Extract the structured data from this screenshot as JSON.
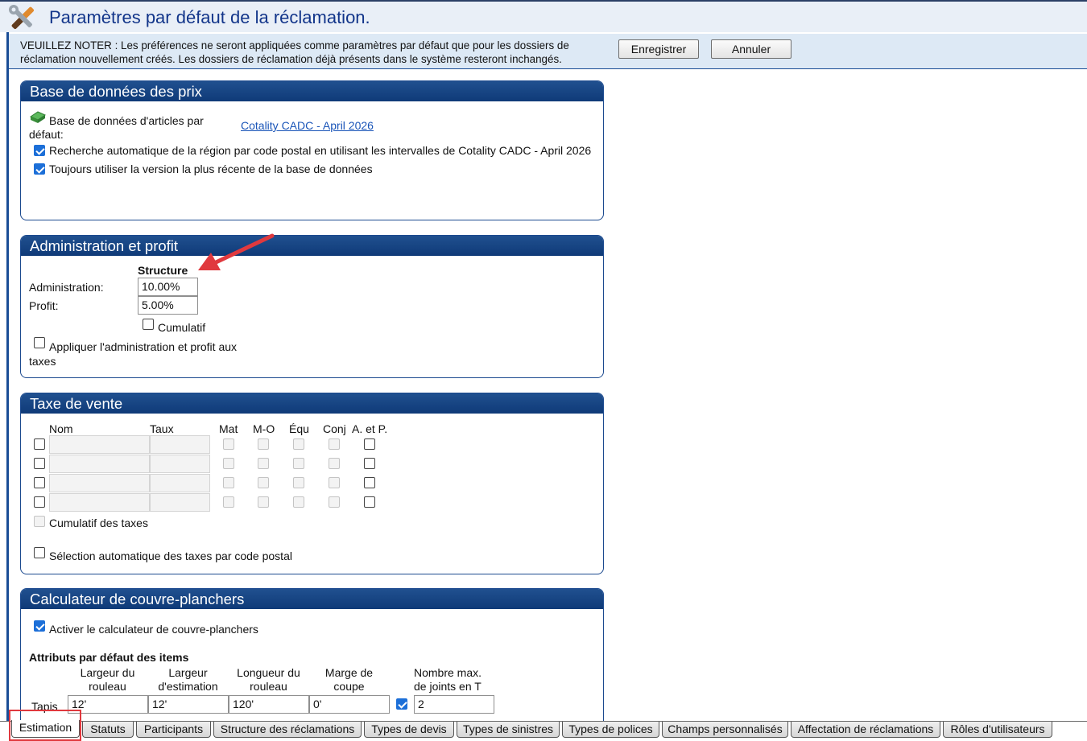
{
  "page": {
    "title": "Paramètres par défaut de la réclamation.",
    "icon": "tools-icon"
  },
  "notice": {
    "text": "VEUILLEZ NOTER : Les préférences ne seront appliquées comme paramètres par défaut que pour les dossiers de réclamation nouvellement créés. Les dossiers de réclamation déjà présents dans le système resteront inchangés.",
    "save_label": "Enregistrer",
    "cancel_label": "Annuler"
  },
  "price_db": {
    "header": "Base de données des prix",
    "default_db_label": "Base de données d'articles par défaut:",
    "default_db_value": "Cotality CADC - April 2026",
    "auto_region_label": "Recherche automatique de la région par code postal en utilisant les intervalles de Cotality CADC - April 2026",
    "auto_region_checked": true,
    "latest_version_label": "Toujours utiliser la version la plus récente de la base de données",
    "latest_version_checked": true
  },
  "admin_profit": {
    "header": "Administration et profit",
    "column_header": "Structure",
    "admin_label": "Administration:",
    "admin_value": "10.00%",
    "profit_label": "Profit:",
    "profit_value": "5.00%",
    "cumulative_label": "Cumulatif",
    "cumulative_checked": false,
    "apply_taxes_label": "Appliquer l'administration et profit aux taxes",
    "apply_taxes_checked": false
  },
  "sales_tax": {
    "header": "Taxe de vente",
    "columns": [
      "Nom",
      "Taux",
      "Mat",
      "M-O",
      "Équ",
      "Conj",
      "A. et P."
    ],
    "rows": [
      {
        "name": "",
        "rate": ""
      },
      {
        "name": "",
        "rate": ""
      },
      {
        "name": "",
        "rate": ""
      },
      {
        "name": "",
        "rate": ""
      }
    ],
    "cumulative_label": "Cumulatif des taxes",
    "auto_select_label": "Sélection automatique des taxes par code postal"
  },
  "flooring": {
    "header": "Calculateur de couvre-planchers",
    "enable_label": "Activer le calculateur de couvre-planchers",
    "enable_checked": true,
    "attributes_title": "Attributs par défaut des items",
    "col_roll_width": "Largeur du rouleau",
    "col_est_width": "Largeur d'estimation",
    "col_roll_length": "Longueur du rouleau",
    "col_cut_margin": "Marge de coupe",
    "col_max_seams": "Nombre max. de joints en T",
    "row_label": "Tapis",
    "roll_width": "12'",
    "est_width": "12'",
    "roll_length": "120'",
    "cut_margin": "0'",
    "seams_checked": true,
    "max_seams": "2"
  },
  "tabs": [
    "Estimation",
    "Statuts",
    "Participants",
    "Structure des réclamations",
    "Types de devis",
    "Types de sinistres",
    "Types de polices",
    "Champs personnalisés",
    "Affectation de réclamations",
    "Rôles d'utilisateurs"
  ],
  "active_tab": "Estimation"
}
